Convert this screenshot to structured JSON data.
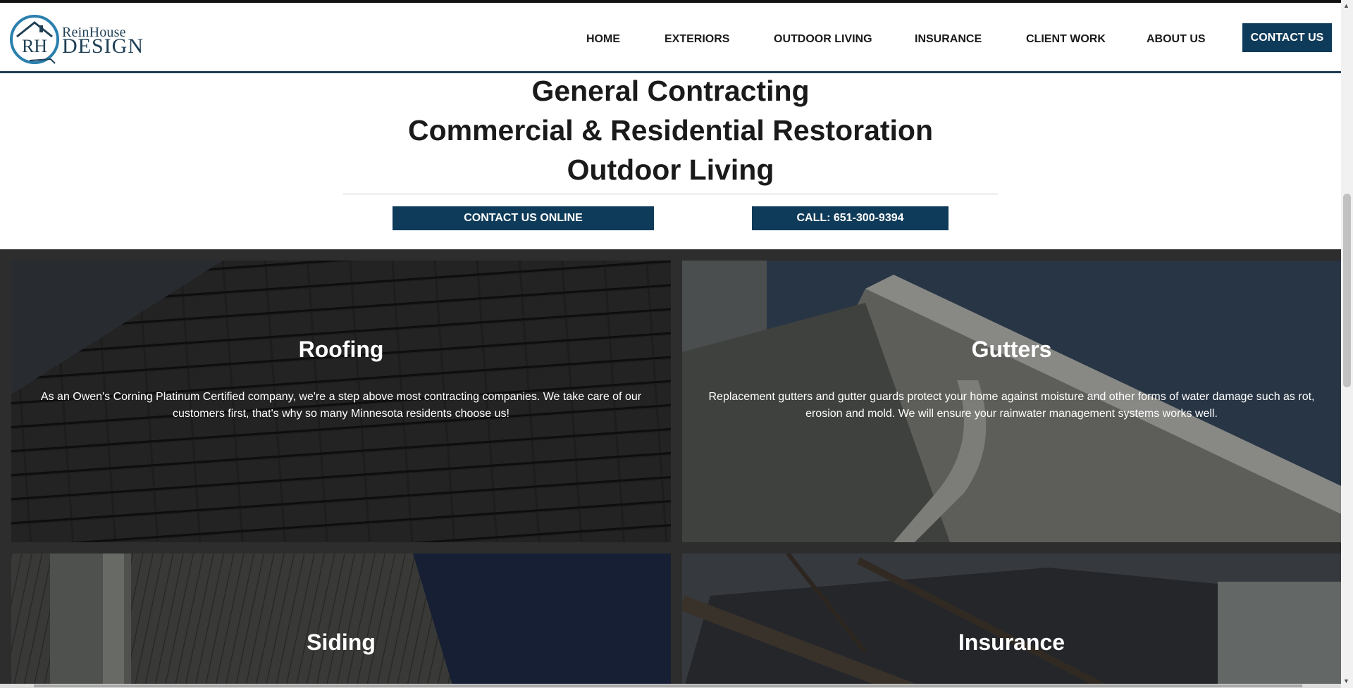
{
  "brand": {
    "monogram": "RH",
    "name_line1": "ReinHouse",
    "name_line2": "DESIGN"
  },
  "nav": {
    "items": [
      {
        "label": "HOME"
      },
      {
        "label": "EXTERIORS"
      },
      {
        "label": "OUTDOOR LIVING"
      },
      {
        "label": "INSURANCE"
      },
      {
        "label": "CLIENT WORK"
      },
      {
        "label": "ABOUT US"
      }
    ],
    "contact_label": "CONTACT US"
  },
  "hero": {
    "line1": "General Contracting",
    "line2": "Commercial & Residential Restoration",
    "line3": "Outdoor Living",
    "cta_online": "CONTACT US ONLINE",
    "cta_call": "CALL: 651-300-9394"
  },
  "services": [
    {
      "title": "Roofing",
      "text": "As an Owen's Corning Platinum Certified company, we're a step above most contracting companies. We take care of our customers first, that's why so many Minnesota residents choose us!"
    },
    {
      "title": "Gutters",
      "text": "Replacement gutters and gutter guards protect your home against moisture and other forms of water damage such as rot, erosion and mold. We will ensure your rainwater management systems works well."
    },
    {
      "title": "Siding",
      "text": ""
    },
    {
      "title": "Insurance",
      "text": ""
    }
  ],
  "colors": {
    "brand_navy": "#0f3b5a",
    "dark_section": "#2d2d2d"
  }
}
